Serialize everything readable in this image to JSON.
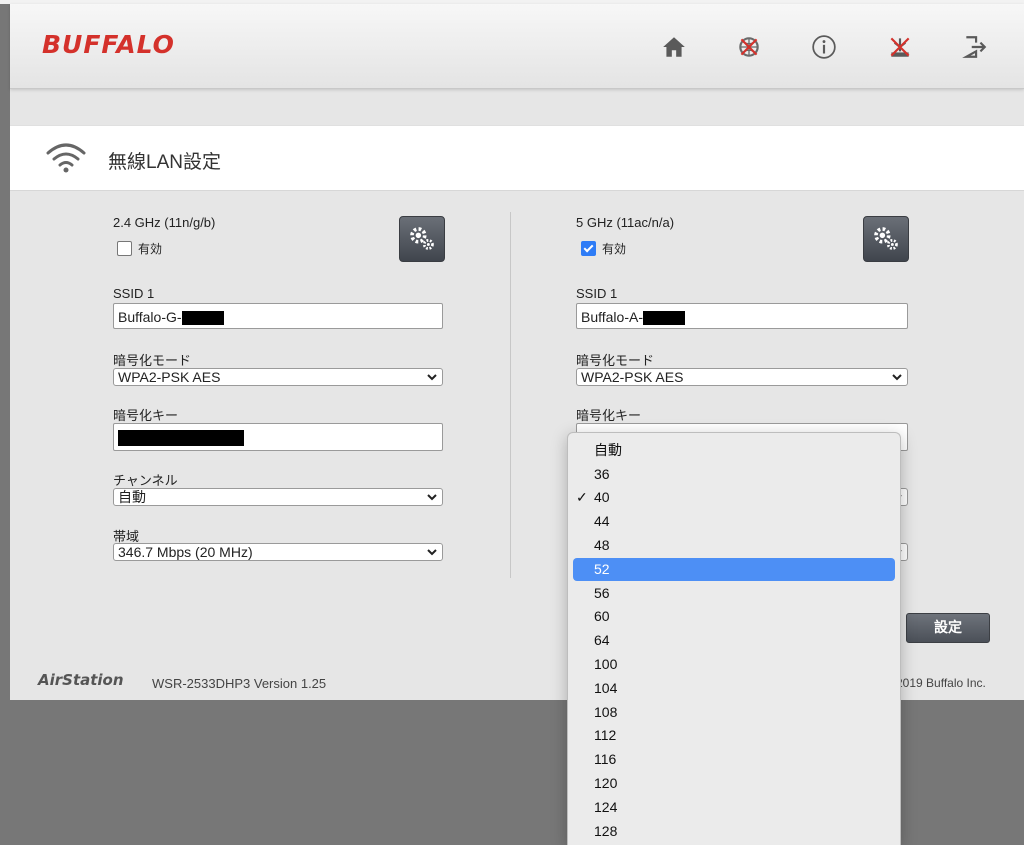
{
  "header": {
    "brand": "BUFFALO",
    "icons": [
      "home-icon",
      "network-disabled-icon",
      "info-icon",
      "antenna-disabled-icon",
      "logout-icon"
    ]
  },
  "page": {
    "title": "無線LAN設定"
  },
  "band24": {
    "title": "2.4 GHz (11n/g/b)",
    "enable_label": "有効",
    "enabled": false,
    "ssid_label": "SSID 1",
    "ssid_value": "Buffalo-G-",
    "security_label": "暗号化モード",
    "security_value": "WPA2-PSK AES",
    "key_label": "暗号化キー",
    "channel_label": "チャンネル",
    "channel_value": "自動",
    "bandwidth_label": "帯域",
    "bandwidth_value": "346.7 Mbps (20 MHz)"
  },
  "band5": {
    "title": "5 GHz (11ac/n/a)",
    "enable_label": "有効",
    "enabled": true,
    "ssid_label": "SSID 1",
    "ssid_value": "Buffalo-A-",
    "security_label": "暗号化モード",
    "security_value": "WPA2-PSK AES",
    "key_label": "暗号化キー"
  },
  "channel_dropdown": {
    "options": [
      "自動",
      "36",
      "40",
      "44",
      "48",
      "52",
      "56",
      "60",
      "64",
      "100",
      "104",
      "108",
      "112",
      "116",
      "120",
      "124",
      "128"
    ],
    "selected": "40",
    "highlighted": "52"
  },
  "actions": {
    "submit_label": "設定"
  },
  "footer": {
    "brand": "AirStation",
    "model": "WSR-2533DHP3   Version 1.25",
    "copyright": "2019 Buffalo Inc."
  },
  "colors": {
    "brand_red": "#d4312b",
    "highlight_blue": "#4d8ff5",
    "button_gray": "#555a62"
  }
}
